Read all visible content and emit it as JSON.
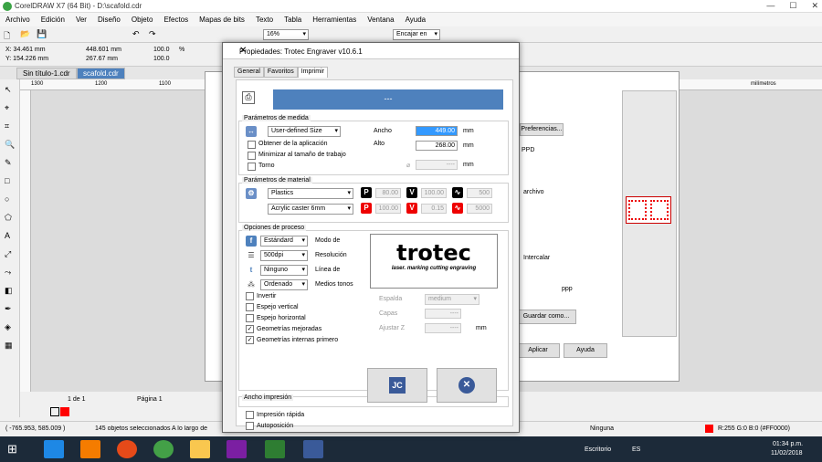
{
  "app_title": "CorelDRAW X7 (64 Bit) - D:\\scafold.cdr",
  "menu": [
    "Archivo",
    "Edición",
    "Ver",
    "Diseño",
    "Objeto",
    "Efectos",
    "Mapas de bits",
    "Texto",
    "Tabla",
    "Herramientas",
    "Ventana",
    "Ayuda"
  ],
  "toolbar": {
    "zoom": "16%",
    "snap": "Encajar en"
  },
  "propbar": {
    "x": "X: 34.461 mm",
    "y": "Y: 154.226 mm",
    "w": "448.601 mm",
    "h": "267.67 mm",
    "sx": "100.0",
    "sy": "100.0",
    "pct": "%"
  },
  "doc_tabs": [
    "Sin título-1.cdr",
    "scafold.cdr"
  ],
  "ruler_units": "milímetros",
  "ruler_ticks": [
    "1300",
    "1200",
    "1100",
    "1000",
    "900",
    "800"
  ],
  "page_nav": {
    "current": "1 de 1",
    "page": "Página 1"
  },
  "background_dialog": {
    "buttons": [
      "Preferencias...",
      "Guardar como...",
      "Aplicar",
      "Ayuda"
    ],
    "labels": [
      "PPD",
      "archivo",
      "Intercalar",
      "ppp"
    ]
  },
  "status": {
    "coords": "( -765.953, 585.009 )",
    "selection": "145 objetos seleccionados A lo largo de",
    "fill": "Ninguna",
    "color": "R:255 G:0 B:0 (#FF0000)"
  },
  "taskbar": {
    "desktop": "Escritorio",
    "lang": "ES",
    "time": "01:34 p.m.",
    "date": "11/02/2018"
  },
  "dialog": {
    "title": "Propiedades: Trotec Engraver v10.6.1",
    "tabs": [
      "General",
      "Favoritos",
      "Imprimir"
    ],
    "banner": "---",
    "medida": {
      "title": "Parámetros de medida",
      "size": "User-defined Size",
      "obtener": "Obtener de la aplicación",
      "minimizar": "Minimizar al tamaño de trabajo",
      "torno": "Torno",
      "ancho_label": "Ancho",
      "ancho": "449.00",
      "alto_label": "Alto",
      "alto": "268.00",
      "mm": "mm",
      "diam": "----"
    },
    "material": {
      "title": "Parámetros de material",
      "mat1": "Plastics",
      "mat2": "Acrylic caster 6mm",
      "p1": "80.00",
      "v1": "100.00",
      "f1": "500",
      "p2": "100.00",
      "v2": "0.15",
      "f2": "5000"
    },
    "proceso": {
      "title": "Opciones de proceso",
      "modo": "Estándard",
      "modo_label": "Modo de",
      "res": "500dpi",
      "res_label": "Resolución",
      "linea": "Ninguno",
      "linea_label": "Línea de",
      "medios": "Ordenado",
      "medios_label": "Medios tonos",
      "invertir": "Invertir",
      "espejo_v": "Espejo vertical",
      "espejo_h": "Espejo horizontal",
      "geo": "Geometrías mejoradas",
      "geo_int": "Geometrías internas primero",
      "espalda_label": "Espalda",
      "espalda": "medium",
      "capas_label": "Capas",
      "capas": "----",
      "ajuste_label": "Ajustar Z",
      "ajuste": "----",
      "mm": "mm"
    },
    "logo": {
      "brand": "trotec",
      "tagline": "laser. marking cutting engraving"
    },
    "ancho": {
      "title": "Ancho impresión",
      "rapida": "Impresión rápida",
      "auto": "Autoposición"
    }
  },
  "colors": {
    "accent": "#4e81bd",
    "red": "#ff0000"
  }
}
